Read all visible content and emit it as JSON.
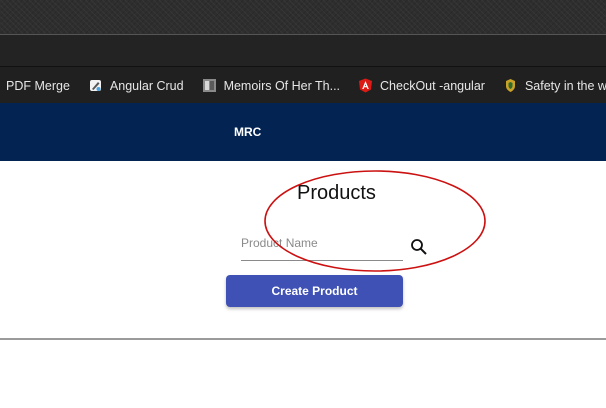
{
  "bookmarks": [
    {
      "label": "PDF Merge",
      "icon": "none"
    },
    {
      "label": "Angular Crud",
      "icon": "pen-tool-icon"
    },
    {
      "label": "Memoirs Of Her Th...",
      "icon": "book-cover-icon"
    },
    {
      "label": "CheckOut -angular",
      "icon": "angular-icon"
    },
    {
      "label": "Safety in the work",
      "icon": "coat-of-arms-icon"
    }
  ],
  "nav": {
    "brand": "MRC",
    "background": "#032352"
  },
  "page": {
    "title": "Products",
    "search": {
      "placeholder": "Product Name",
      "value": ""
    },
    "create_button": "Create Product",
    "accent": "#3f51b5"
  },
  "annotation": {
    "shape": "ellipse",
    "color": "#cc1111"
  }
}
